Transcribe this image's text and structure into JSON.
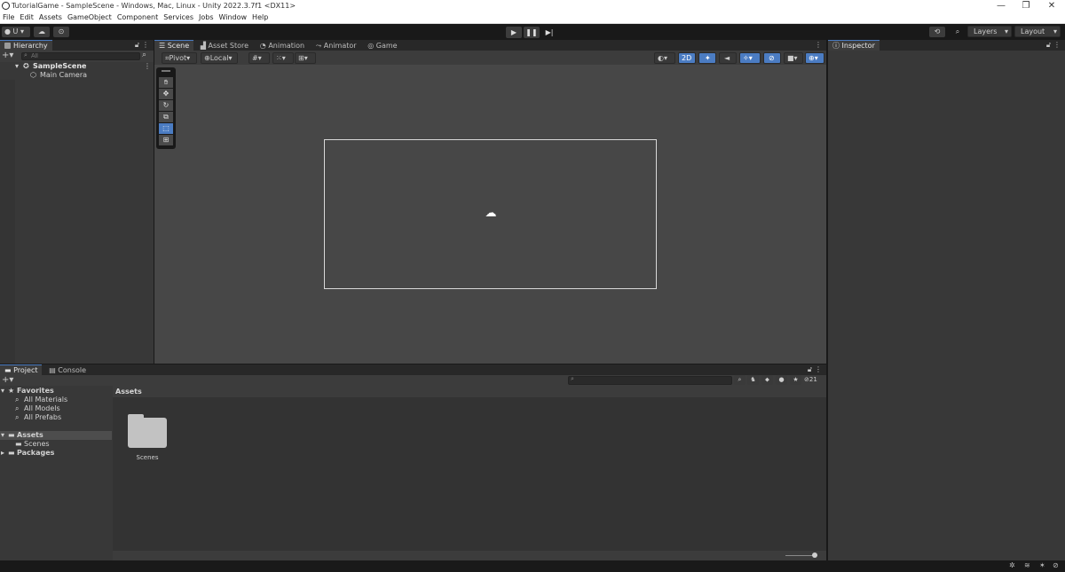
{
  "window": {
    "title": "TutorialGame - SampleScene - Windows, Mac, Linux - Unity 2022.3.7f1 <DX11>",
    "controls": [
      "—",
      "❐",
      "✕"
    ]
  },
  "menu": [
    "File",
    "Edit",
    "Assets",
    "GameObject",
    "Component",
    "Services",
    "Jobs",
    "Window",
    "Help"
  ],
  "toolbar": {
    "account_label": "U",
    "layers_label": "Layers",
    "layout_label": "Layout"
  },
  "hierarchy": {
    "tab_label": "Hierarchy",
    "search_placeholder": "All",
    "scene_name": "SampleScene",
    "objects": [
      "Main Camera"
    ]
  },
  "scene_view": {
    "tabs": [
      "Scene",
      "Asset Store",
      "Animation",
      "Animator",
      "Game"
    ],
    "pivot_label": "Pivot",
    "local_label": "Local",
    "mode_2d_label": "2D"
  },
  "inspector": {
    "tab_label": "Inspector"
  },
  "project": {
    "tabs": [
      "Project",
      "Console"
    ],
    "favorites_label": "Favorites",
    "favorites": [
      "All Materials",
      "All Models",
      "All Prefabs"
    ],
    "tree": {
      "assets_label": "Assets",
      "assets_children": [
        "Scenes"
      ],
      "packages_label": "Packages"
    },
    "breadcrumb": "Assets",
    "hidden_count": "21",
    "items": [
      {
        "name": "Scenes",
        "type": "folder"
      }
    ]
  },
  "colors": {
    "accent": "#4b7cc2",
    "panel_bg": "#383838",
    "scene_bg": "#474747",
    "window_chrome": "#191919"
  }
}
